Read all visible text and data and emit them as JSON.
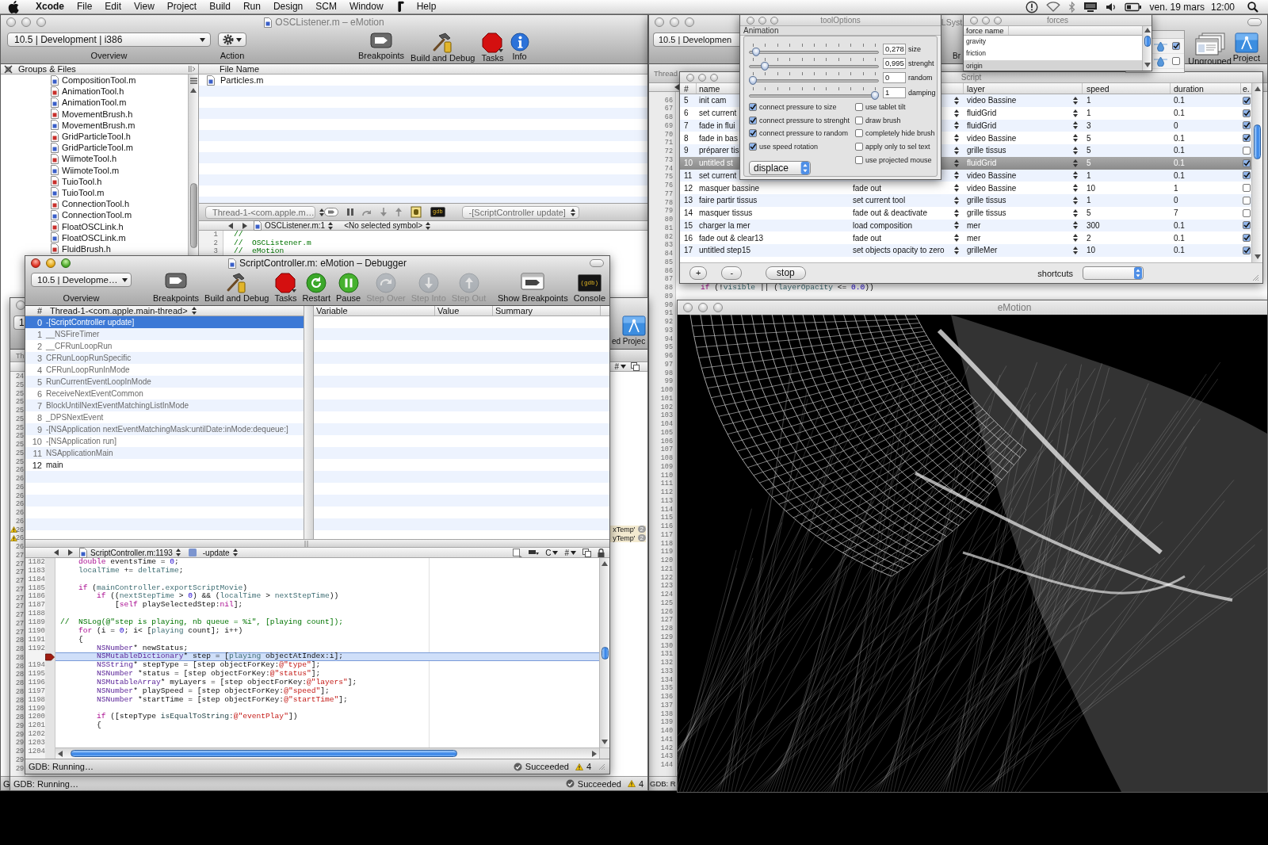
{
  "menu_bar": {
    "menus": [
      {
        "kind": "apple"
      },
      {
        "kind": "app",
        "label": "Xcode"
      },
      {
        "kind": "menu",
        "label": "File"
      },
      {
        "kind": "menu",
        "label": "Edit"
      },
      {
        "kind": "menu",
        "label": "View"
      },
      {
        "kind": "menu",
        "label": "Project"
      },
      {
        "kind": "menu",
        "label": "Build"
      },
      {
        "kind": "menu",
        "label": "Run"
      },
      {
        "kind": "menu",
        "label": "Design"
      },
      {
        "kind": "menu",
        "label": "SCM"
      },
      {
        "kind": "menu",
        "label": "Window"
      },
      {
        "kind": "script"
      },
      {
        "kind": "menu",
        "label": "Help"
      }
    ],
    "date": "ven. 19 mars",
    "time": "12:00"
  },
  "project_window": {
    "active": false,
    "title": "OSCListener.m – eMotion",
    "overview_popup": "10.5 | Development | i386",
    "overview_label": "Overview",
    "action_label": "Action",
    "toolbar": [
      {
        "kind": "breakpoints",
        "label": "Breakpoints"
      },
      {
        "kind": "build",
        "label": "Build and Debug"
      },
      {
        "kind": "tasks",
        "label": "Tasks"
      },
      {
        "kind": "info",
        "label": "Info"
      }
    ],
    "groups_header": "Groups & Files",
    "files": [
      {
        "name": "CompositionTool.m",
        "kind": "source"
      },
      {
        "name": "AnimationTool.h",
        "kind": "header"
      },
      {
        "name": "AnimationTool.m",
        "kind": "source"
      },
      {
        "name": "MovementBrush.h",
        "kind": "header"
      },
      {
        "name": "MovementBrush.m",
        "kind": "source"
      },
      {
        "name": "GridParticleTool.h",
        "kind": "header"
      },
      {
        "name": "GridParticleTool.m",
        "kind": "source"
      },
      {
        "name": "WiimoteTool.h",
        "kind": "header"
      },
      {
        "name": "WiimoteTool.m",
        "kind": "source"
      },
      {
        "name": "TuioTool.h",
        "kind": "header"
      },
      {
        "name": "TuioTool.m",
        "kind": "source"
      },
      {
        "name": "ConnectionTool.h",
        "kind": "header"
      },
      {
        "name": "ConnectionTool.m",
        "kind": "source"
      },
      {
        "name": "FloatOSCLink.h",
        "kind": "header"
      },
      {
        "name": "FloatOSCLink.m",
        "kind": "source"
      },
      {
        "name": "FluidBrush.h",
        "kind": "header"
      }
    ],
    "file_list": {
      "column": "File Name",
      "rows": [
        {
          "name": "Particles.m",
          "kind": "source"
        }
      ]
    },
    "debug_bar": {
      "thread": "Thread-1-<com.apple.m…",
      "console_label": "gdb",
      "function": "-[ScriptController update]"
    },
    "nav": {
      "file": "OSCListener.m:1",
      "symbol": "<No selected symbol>"
    },
    "code": [
      {
        "number": "1",
        "tokens": [
          {
            "kind": "comment",
            "text": "//"
          }
        ]
      },
      {
        "number": "2",
        "tokens": [
          {
            "kind": "comment",
            "text": "//  OSCListener.m"
          }
        ]
      },
      {
        "number": "3",
        "tokens": [
          {
            "kind": "comment",
            "text": "//  eMotion"
          }
        ]
      }
    ],
    "status": "G"
  },
  "right_window": {
    "active": false,
    "title": "LSyst",
    "overview_popup": "10.5 | Developmen",
    "toolbar": [
      {
        "kind": "label",
        "label": "Br"
      },
      {
        "kind": "ungrouped",
        "label": "Ungrouped"
      },
      {
        "kind": "project",
        "label": "Project"
      }
    ],
    "strip": "Thread",
    "lines": [
      {
        "number": "66"
      },
      {
        "number": "67"
      },
      {
        "number": "68"
      },
      {
        "number": "69"
      },
      {
        "number": "70"
      },
      {
        "number": "71"
      },
      {
        "number": "72"
      },
      {
        "number": "73"
      },
      {
        "number": "74"
      },
      {
        "number": "75"
      },
      {
        "number": "76"
      },
      {
        "number": "77"
      },
      {
        "number": "78"
      },
      {
        "number": "79"
      },
      {
        "number": "80"
      },
      {
        "number": "81"
      },
      {
        "number": "82"
      },
      {
        "number": "83"
      },
      {
        "number": "84"
      },
      {
        "number": "85"
      },
      {
        "number": "86"
      },
      {
        "number": "87"
      },
      {
        "number": "88",
        "tokens": [
          {
            "kind": "keyword",
            "text": "    if"
          },
          {
            "kind": "plain",
            "text": " (!"
          },
          {
            "kind": "ident",
            "text": "visible"
          },
          {
            "kind": "plain",
            "text": " || ("
          },
          {
            "kind": "ident",
            "text": "layerOpacity"
          },
          {
            "kind": "plain",
            "text": " <= "
          },
          {
            "kind": "number",
            "text": "0.0"
          },
          {
            "kind": "plain",
            "text": "))"
          }
        ]
      },
      {
        "number": "89"
      },
      {
        "number": "90"
      },
      {
        "number": "91"
      },
      {
        "number": "92"
      },
      {
        "number": "93"
      },
      {
        "number": "94"
      },
      {
        "number": "95"
      },
      {
        "number": "96"
      },
      {
        "number": "97"
      },
      {
        "number": "98"
      },
      {
        "number": "99"
      },
      {
        "number": "100"
      },
      {
        "number": "101"
      },
      {
        "number": "102"
      },
      {
        "number": "103"
      },
      {
        "number": "104"
      },
      {
        "number": "105"
      },
      {
        "number": "106"
      },
      {
        "number": "107"
      },
      {
        "number": "108"
      },
      {
        "number": "109"
      },
      {
        "number": "110"
      },
      {
        "number": "111"
      },
      {
        "number": "112"
      },
      {
        "number": "113"
      },
      {
        "number": "114"
      },
      {
        "number": "115"
      },
      {
        "number": "116"
      },
      {
        "number": "117"
      },
      {
        "number": "118"
      },
      {
        "number": "119"
      },
      {
        "number": "120"
      },
      {
        "number": "121"
      },
      {
        "number": "122"
      },
      {
        "number": "123"
      },
      {
        "number": "124"
      },
      {
        "number": "125"
      },
      {
        "number": "126"
      },
      {
        "number": "127"
      },
      {
        "number": "128"
      },
      {
        "number": "129"
      },
      {
        "number": "130"
      },
      {
        "number": "131"
      },
      {
        "number": "132"
      },
      {
        "number": "133"
      },
      {
        "number": "134"
      },
      {
        "number": "135"
      },
      {
        "number": "136"
      },
      {
        "number": "137"
      },
      {
        "number": "138"
      },
      {
        "number": "139"
      },
      {
        "number": "140"
      },
      {
        "number": "141"
      },
      {
        "number": "142"
      },
      {
        "number": "143"
      },
      {
        "number": "144"
      }
    ],
    "status": "GDB: R"
  },
  "layer_panel": {
    "rows": [
      {
        "checked": true
      },
      {
        "checked": false
      }
    ]
  },
  "back_window": {
    "active": false,
    "overview_popup": "1",
    "toolbar": [
      {
        "kind": "label",
        "label": "ed"
      },
      {
        "kind": "project",
        "label": "Projec"
      }
    ],
    "strip": "Th",
    "nav_menus": [
      "#"
    ],
    "gutter": [
      {
        "text": "24",
        "warning": false
      },
      {
        "text": "25",
        "warning": false
      },
      {
        "text": "25",
        "warning": false
      },
      {
        "text": "25",
        "warning": false
      },
      {
        "text": "25",
        "warning": false
      },
      {
        "text": "25",
        "warning": false
      },
      {
        "text": "25",
        "warning": false
      },
      {
        "text": "25",
        "warning": false
      },
      {
        "text": "25",
        "warning": false
      },
      {
        "text": "25",
        "warning": false
      },
      {
        "text": "25",
        "warning": false
      },
      {
        "text": "26",
        "warning": false
      },
      {
        "text": "26",
        "warning": false
      },
      {
        "text": "26",
        "warning": false
      },
      {
        "text": "26",
        "warning": false
      },
      {
        "text": "26",
        "warning": false
      },
      {
        "text": "26",
        "warning": false
      },
      {
        "text": "26",
        "warning": false
      },
      {
        "text": "26",
        "warning": true
      },
      {
        "text": "26",
        "warning": true
      },
      {
        "text": "26",
        "warning": false
      },
      {
        "text": "27",
        "warning": false
      },
      {
        "text": "27",
        "warning": false
      },
      {
        "text": "27",
        "warning": false
      },
      {
        "text": "27",
        "warning": false
      },
      {
        "text": "27",
        "warning": false
      },
      {
        "text": "27",
        "warning": false
      },
      {
        "text": "27",
        "warning": false
      },
      {
        "text": "27",
        "warning": false
      },
      {
        "text": "27",
        "warning": false
      },
      {
        "text": "27",
        "warning": false
      },
      {
        "text": "28",
        "warning": false
      },
      {
        "text": "28",
        "warning": false
      },
      {
        "text": "28",
        "warning": false
      },
      {
        "text": "28",
        "warning": false
      },
      {
        "text": "28",
        "warning": false
      },
      {
        "text": "28",
        "warning": false
      },
      {
        "text": "28",
        "warning": false
      },
      {
        "text": "28",
        "warning": false
      },
      {
        "text": "28",
        "warning": false
      },
      {
        "text": "28",
        "warning": false
      },
      {
        "text": "29",
        "warning": false
      },
      {
        "text": "29",
        "warning": false
      },
      {
        "text": "29",
        "warning": false
      },
      {
        "text": "29",
        "warning": false
      },
      {
        "text": "29",
        "warning": false
      },
      {
        "text": "29",
        "warning": false
      }
    ],
    "messages": [
      {
        "text": "xTemp'",
        "count": "2"
      },
      {
        "text": "yTemp'",
        "count": "2"
      }
    ],
    "status": "GDB: Running…",
    "result": "Succeeded",
    "warnings": "4"
  },
  "debugger": {
    "active": true,
    "title": "ScriptController.m: eMotion – Debugger",
    "overview_popup": "10.5 | Developme…",
    "overview_label": "Overview",
    "toolbar": [
      {
        "kind": "breakpoints",
        "label": "Breakpoints",
        "disabled": false
      },
      {
        "kind": "build",
        "label": "Build and Debug",
        "disabled": false
      },
      {
        "kind": "tasks",
        "label": "Tasks",
        "disabled": false
      },
      {
        "kind": "restart",
        "label": "Restart",
        "disabled": false
      },
      {
        "kind": "pause",
        "label": "Pause",
        "disabled": false
      },
      {
        "kind": "step-over",
        "label": "Step Over",
        "disabled": true
      },
      {
        "kind": "step-into",
        "label": "Step Into",
        "disabled": true
      },
      {
        "kind": "step-out",
        "label": "Step Out",
        "disabled": true
      },
      {
        "kind": "flexible-space"
      },
      {
        "kind": "show-breakpoints",
        "label": "Show Breakpoints",
        "disabled": false
      },
      {
        "kind": "console",
        "label": "Console",
        "disabled": false,
        "icon_text": "(gdb)"
      }
    ],
    "stack": {
      "number_header": "#",
      "thread": "Thread-1-<com.apple.main-thread>",
      "frames": [
        {
          "number": "0",
          "name": "-[ScriptController update]",
          "selected": true,
          "has_source": true
        },
        {
          "number": "1",
          "name": "__NSFireTimer",
          "selected": false,
          "has_source": false
        },
        {
          "number": "2",
          "name": "__CFRunLoopRun",
          "selected": false,
          "has_source": false
        },
        {
          "number": "3",
          "name": "CFRunLoopRunSpecific",
          "selected": false,
          "has_source": false
        },
        {
          "number": "4",
          "name": "CFRunLoopRunInMode",
          "selected": false,
          "has_source": false
        },
        {
          "number": "5",
          "name": "RunCurrentEventLoopInMode",
          "selected": false,
          "has_source": false
        },
        {
          "number": "6",
          "name": "ReceiveNextEventCommon",
          "selected": false,
          "has_source": false
        },
        {
          "number": "7",
          "name": "BlockUntilNextEventMatchingListInMode",
          "selected": false,
          "has_source": false
        },
        {
          "number": "8",
          "name": "_DPSNextEvent",
          "selected": false,
          "has_source": false
        },
        {
          "number": "9",
          "name": "-[NSApplication nextEventMatchingMask:untilDate:inMode:dequeue:]",
          "selected": false,
          "has_source": false
        },
        {
          "number": "10",
          "name": "-[NSApplication run]",
          "selected": false,
          "has_source": false
        },
        {
          "number": "11",
          "name": "NSApplicationMain",
          "selected": false,
          "has_source": false
        },
        {
          "number": "12",
          "name": "main",
          "selected": false,
          "has_source": true
        }
      ]
    },
    "variables": {
      "columns": [
        "Variable",
        "Value",
        "Summary"
      ]
    },
    "editor": {
      "file": "ScriptController.m:1193",
      "symbol": "-update",
      "nav_menus": [
        "C",
        "#"
      ],
      "lines": [
        {
          "number": "1182",
          "current": false,
          "tokens": [
            {
              "kind": "keyword",
              "text": "    double"
            },
            {
              "kind": "plain",
              "text": " eventsTime = "
            },
            {
              "kind": "number",
              "text": "0"
            },
            {
              "kind": "plain",
              "text": ";"
            }
          ]
        },
        {
          "number": "1183",
          "current": false,
          "tokens": [
            {
              "kind": "ident",
              "text": "    localTime"
            },
            {
              "kind": "plain",
              "text": " += "
            },
            {
              "kind": "ident",
              "text": "deltaTime"
            },
            {
              "kind": "plain",
              "text": ";"
            }
          ]
        },
        {
          "number": "1184",
          "current": false
        },
        {
          "number": "1185",
          "current": false,
          "tokens": [
            {
              "kind": "keyword",
              "text": "    if"
            },
            {
              "kind": "plain",
              "text": " ("
            },
            {
              "kind": "ident",
              "text": "mainController"
            },
            {
              "kind": "plain",
              "text": "."
            },
            {
              "kind": "ident",
              "text": "exportScriptMovie"
            },
            {
              "kind": "plain",
              "text": ")"
            }
          ]
        },
        {
          "number": "1186",
          "current": false,
          "tokens": [
            {
              "kind": "keyword",
              "text": "        if"
            },
            {
              "kind": "plain",
              "text": " (("
            },
            {
              "kind": "ident",
              "text": "nextStepTime"
            },
            {
              "kind": "plain",
              "text": " > "
            },
            {
              "kind": "number",
              "text": "0"
            },
            {
              "kind": "plain",
              "text": ") && ("
            },
            {
              "kind": "ident",
              "text": "localTime"
            },
            {
              "kind": "plain",
              "text": " > "
            },
            {
              "kind": "ident",
              "text": "nextStepTime"
            },
            {
              "kind": "plain",
              "text": "))"
            }
          ]
        },
        {
          "number": "1187",
          "current": false,
          "tokens": [
            {
              "kind": "plain",
              "text": "            ["
            },
            {
              "kind": "keyword",
              "text": "self"
            },
            {
              "kind": "plain",
              "text": " playSelectedStep:"
            },
            {
              "kind": "keyword",
              "text": "nil"
            },
            {
              "kind": "plain",
              "text": "];"
            }
          ]
        },
        {
          "number": "1188",
          "current": false
        },
        {
          "number": "1189",
          "current": false,
          "tokens": [
            {
              "kind": "comment",
              "text": "//  NSLog(@\"step is playing, nb queue = %i\", [playing count]);"
            }
          ]
        },
        {
          "number": "1190",
          "current": false,
          "tokens": [
            {
              "kind": "keyword",
              "text": "    for"
            },
            {
              "kind": "plain",
              "text": " (i = "
            },
            {
              "kind": "number",
              "text": "0"
            },
            {
              "kind": "plain",
              "text": "; i< ["
            },
            {
              "kind": "ident",
              "text": "playing"
            },
            {
              "kind": "plain",
              "text": " count]; i++)"
            }
          ]
        },
        {
          "number": "1191",
          "current": false,
          "tokens": [
            {
              "kind": "plain",
              "text": "    {"
            }
          ]
        },
        {
          "number": "1192",
          "current": false,
          "tokens": [
            {
              "kind": "class",
              "text": "        NSNumber"
            },
            {
              "kind": "plain",
              "text": "* newStatus;"
            }
          ]
        },
        {
          "current": true,
          "tokens": [
            {
              "kind": "class",
              "text": "        NSMutableDictionary"
            },
            {
              "kind": "plain",
              "text": "* step = ["
            },
            {
              "kind": "ident",
              "text": "playing"
            },
            {
              "kind": "plain",
              "text": " objectAtIndex:i];"
            }
          ]
        },
        {
          "number": "1194",
          "current": false,
          "tokens": [
            {
              "kind": "class",
              "text": "        NSString"
            },
            {
              "kind": "plain",
              "text": "* stepType = [step objectForKey:"
            },
            {
              "kind": "string",
              "text": "@\"type\""
            },
            {
              "kind": "plain",
              "text": "];"
            }
          ]
        },
        {
          "number": "1195",
          "current": false,
          "tokens": [
            {
              "kind": "class",
              "text": "        NSNumber"
            },
            {
              "kind": "plain",
              "text": " *status = [step objectForKey:"
            },
            {
              "kind": "string",
              "text": "@\"status\""
            },
            {
              "kind": "plain",
              "text": "];"
            }
          ]
        },
        {
          "number": "1196",
          "current": false,
          "tokens": [
            {
              "kind": "class",
              "text": "        NSMutableArray"
            },
            {
              "kind": "plain",
              "text": "* myLayers = [step objectForKey:"
            },
            {
              "kind": "string",
              "text": "@\"layers\""
            },
            {
              "kind": "plain",
              "text": "];"
            }
          ]
        },
        {
          "number": "1197",
          "current": false,
          "tokens": [
            {
              "kind": "class",
              "text": "        NSNumber"
            },
            {
              "kind": "plain",
              "text": "* playSpeed = [step objectForKey:"
            },
            {
              "kind": "string",
              "text": "@\"speed\""
            },
            {
              "kind": "plain",
              "text": "];"
            }
          ]
        },
        {
          "number": "1198",
          "current": false,
          "tokens": [
            {
              "kind": "class",
              "text": "        NSNumber"
            },
            {
              "kind": "plain",
              "text": " *startTime = [step objectForKey:"
            },
            {
              "kind": "string",
              "text": "@\"startTime\""
            },
            {
              "kind": "plain",
              "text": "];"
            }
          ]
        },
        {
          "number": "1199",
          "current": false
        },
        {
          "number": "1200",
          "current": false,
          "tokens": [
            {
              "kind": "keyword",
              "text": "        if"
            },
            {
              "kind": "plain",
              "text": " ([stepType "
            },
            {
              "kind": "method",
              "text": "isEqualToString:"
            },
            {
              "kind": "string",
              "text": "@\"eventPlay\""
            },
            {
              "kind": "plain",
              "text": "])"
            }
          ]
        },
        {
          "number": "1201",
          "current": false,
          "tokens": [
            {
              "kind": "plain",
              "text": "        {"
            }
          ]
        },
        {
          "number": "1202",
          "current": false
        },
        {
          "number": "1203",
          "current": false
        },
        {
          "number": "1204",
          "current": false
        }
      ]
    },
    "status": "GDB: Running…",
    "result": "Succeeded",
    "warnings": "4"
  },
  "render_window": {
    "active": false,
    "title": "eMotion"
  },
  "script": {
    "active": false,
    "title": "Script",
    "columns": [
      {
        "kind": "number",
        "label": "#"
      },
      {
        "kind": "name",
        "label": "name"
      },
      {
        "kind": "action"
      },
      {
        "kind": "layer",
        "label": "layer"
      },
      {
        "kind": "speed",
        "label": "speed"
      },
      {
        "kind": "duration",
        "label": "duration"
      },
      {
        "kind": "enabled",
        "label": "e."
      }
    ],
    "rows": [
      {
        "number": "5",
        "name": "init cam",
        "layer": "video Bassine",
        "speed": "1",
        "duration": "0.1",
        "checked": true,
        "selected": false
      },
      {
        "number": "6",
        "name": "set current",
        "layer": "fluidGrid",
        "speed": "1",
        "duration": "0.1",
        "checked": true,
        "selected": false
      },
      {
        "number": "7",
        "name": "fade in flui",
        "layer": "fluidGrid",
        "speed": "3",
        "duration": "0",
        "checked": true,
        "selected": false
      },
      {
        "number": "8",
        "name": "fade in bas",
        "layer": "video Bassine",
        "speed": "5",
        "duration": "0.1",
        "checked": true,
        "selected": false
      },
      {
        "number": "9",
        "name": "préparer tis",
        "layer": "grille tissus",
        "speed": "5",
        "duration": "0.1",
        "checked": false,
        "selected": false
      },
      {
        "number": "10",
        "name": "untitled st",
        "layer": "fluidGrid",
        "speed": "5",
        "duration": "0.1",
        "checked": true,
        "selected": true
      },
      {
        "number": "11",
        "name": "set current",
        "layer": "video Bassine",
        "speed": "1",
        "duration": "0.1",
        "checked": true,
        "selected": false
      },
      {
        "number": "12",
        "name": "masquer bassine",
        "action": "fade out",
        "layer": "video Bassine",
        "speed": "10",
        "duration": "1",
        "checked": false,
        "selected": false
      },
      {
        "number": "13",
        "name": "faire partir tissus",
        "action": "set current tool",
        "layer": "grille tissus",
        "speed": "1",
        "duration": "0",
        "checked": false,
        "selected": false
      },
      {
        "number": "14",
        "name": "masquer tissus",
        "action": "fade out & deactivate",
        "layer": "grille tissus",
        "speed": "5",
        "duration": "7",
        "checked": false,
        "selected": false
      },
      {
        "number": "15",
        "name": "charger la mer",
        "action": "load composition",
        "layer": "mer",
        "speed": "300",
        "duration": "0.1",
        "checked": true,
        "selected": false
      },
      {
        "number": "16",
        "name": "fade out & clear13",
        "action": "fade out",
        "layer": "mer",
        "speed": "2",
        "duration": "0.1",
        "checked": true,
        "selected": false
      },
      {
        "number": "17",
        "name": "untitled step15",
        "action": "set objects opacity to zero",
        "layer": "grilleMer",
        "speed": "10",
        "duration": "0.1",
        "checked": true,
        "selected": false
      }
    ],
    "buttons": [
      {
        "kind": "add",
        "label": "+"
      },
      {
        "kind": "remove",
        "label": "-"
      },
      {
        "kind": "stop",
        "label": "stop"
      }
    ],
    "shortcuts_label": "shortcuts"
  },
  "tool_options": {
    "active": false,
    "title": "toolOptions",
    "section": "Animation",
    "sliders": [
      {
        "label": "size",
        "value": "0,278",
        "level": 0.028
      },
      {
        "label": "strenght",
        "value": "0,995",
        "level": 0.1
      },
      {
        "label": "random",
        "value": "0",
        "level": 0
      },
      {
        "label": "damping",
        "value": "1",
        "level": 1
      }
    ],
    "left_options": [
      {
        "label": "connect pressure to size",
        "checked": true
      },
      {
        "label": "connect pressure to strenght",
        "checked": true
      },
      {
        "label": "connect pressure to random",
        "checked": true
      },
      {
        "label": "use speed rotation",
        "checked": true
      }
    ],
    "right_options": [
      {
        "label": "use tablet tilt",
        "checked": false
      },
      {
        "label": "draw brush",
        "checked": false
      },
      {
        "label": "completely hide brush",
        "checked": false
      },
      {
        "label": "apply only to sel text",
        "checked": false
      },
      {
        "label": "use projected mouse",
        "checked": false
      }
    ],
    "mode": "displace"
  },
  "forces": {
    "active": false,
    "title": "forces",
    "column": "force name",
    "rows": [
      {
        "name": "gravity",
        "selected": false
      },
      {
        "name": "friction",
        "selected": false
      },
      {
        "name": "origin",
        "selected": true
      }
    ]
  }
}
